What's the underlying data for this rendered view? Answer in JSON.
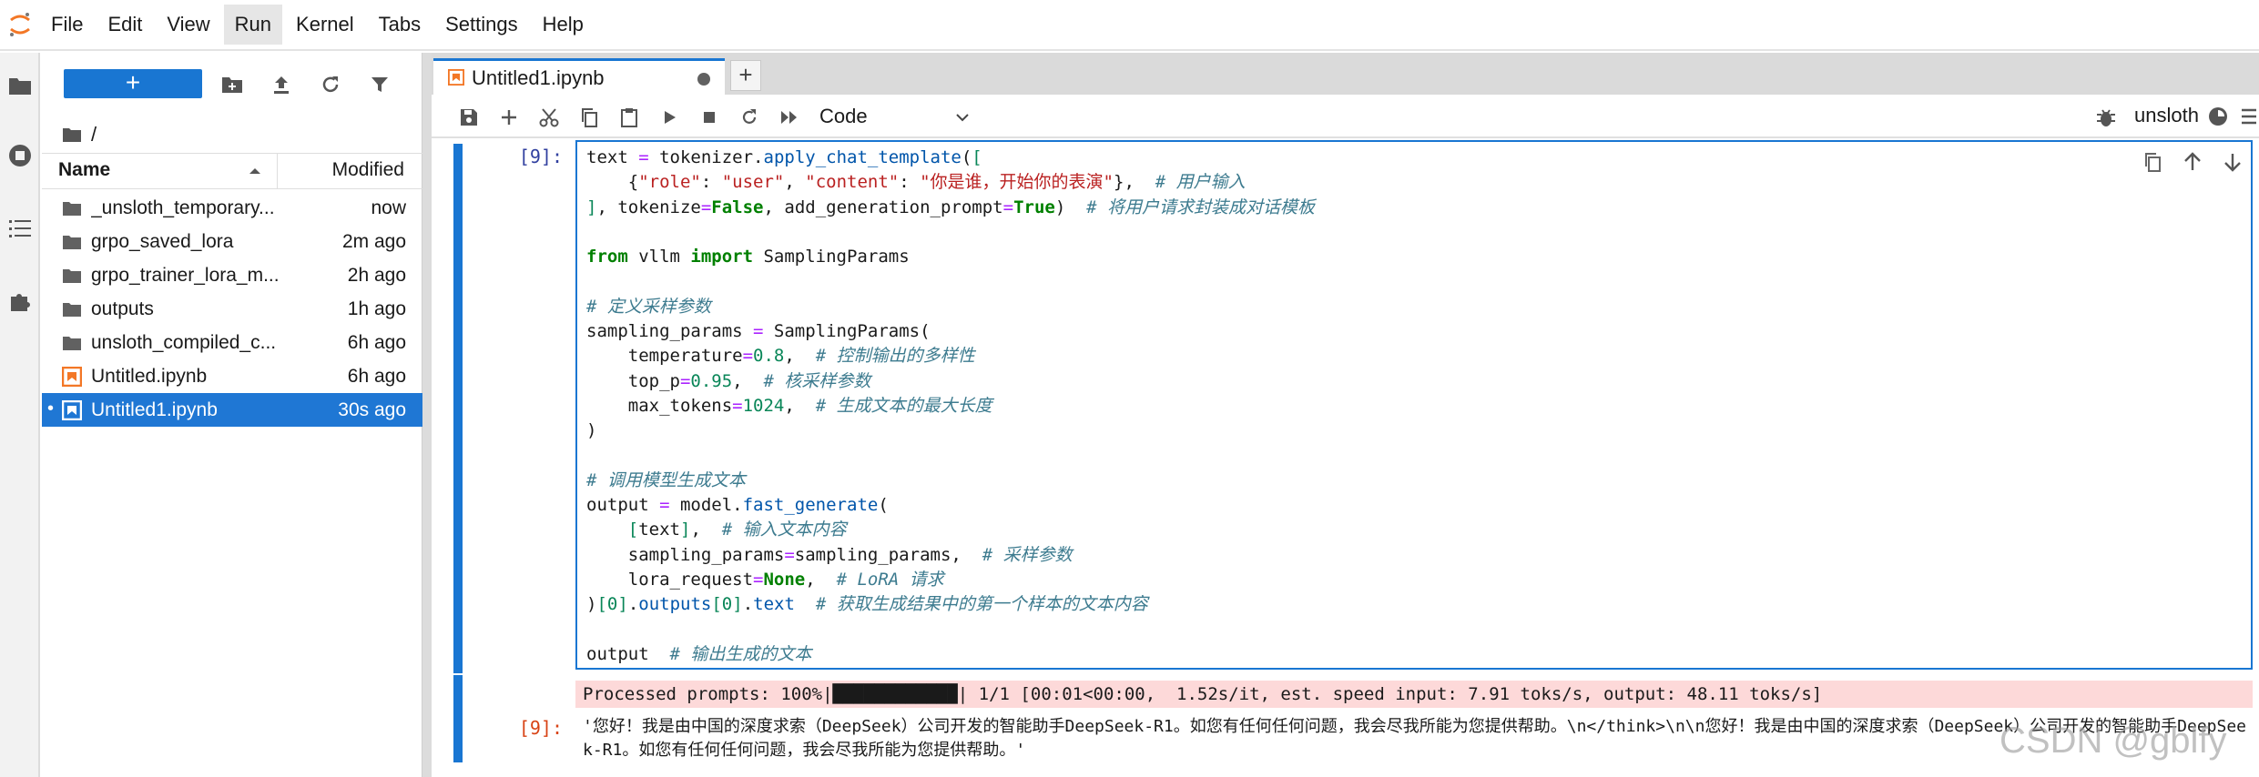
{
  "menubar": {
    "items": [
      "File",
      "Edit",
      "View",
      "Run",
      "Kernel",
      "Tabs",
      "Settings",
      "Help"
    ],
    "active": "Run"
  },
  "filebrowser": {
    "new_label": "+",
    "breadcrumb": "/",
    "columns": {
      "name": "Name",
      "modified": "Modified"
    },
    "files": [
      {
        "name": "_unsloth_temporary...",
        "modified": "now",
        "type": "folder"
      },
      {
        "name": "grpo_saved_lora",
        "modified": "2m ago",
        "type": "folder"
      },
      {
        "name": "grpo_trainer_lora_m...",
        "modified": "2h ago",
        "type": "folder"
      },
      {
        "name": "outputs",
        "modified": "1h ago",
        "type": "folder"
      },
      {
        "name": "unsloth_compiled_c...",
        "modified": "6h ago",
        "type": "folder"
      },
      {
        "name": "Untitled.ipynb",
        "modified": "6h ago",
        "type": "notebook"
      },
      {
        "name": "Untitled1.ipynb",
        "modified": "30s ago",
        "type": "notebook",
        "selected": true,
        "running": true
      }
    ],
    "running_dot": "•"
  },
  "notebook": {
    "tab_title": "Untitled1.ipynb",
    "add_tab": "+",
    "cell_type": "Code",
    "kernel_name": "unsloth",
    "input_prompt": "[9]:",
    "output_prompt": "[9]:",
    "code_lines": [
      "text = tokenizer.apply_chat_template([",
      "    {\"role\": \"user\", \"content\": \"你是谁，开始你的表演\"},  # 用户输入",
      "], tokenize=False, add_generation_prompt=True)  # 将用户请求封装成对话模板",
      "",
      "from vllm import SamplingParams",
      "",
      "# 定义采样参数",
      "sampling_params = SamplingParams(",
      "    temperature=0.8,  # 控制输出的多样性",
      "    top_p=0.95,  # 核采样参数",
      "    max_tokens=1024,  # 生成文本的最大长度",
      ")",
      "",
      "# 调用模型生成文本",
      "output = model.fast_generate(",
      "    [text],  # 输入文本内容",
      "    sampling_params=sampling_params,  # 采样参数",
      "    lora_request=None,  # LoRA 请求",
      ")[0].outputs[0].text  # 获取生成结果中的第一个样本的文本内容",
      "",
      "output  # 输出生成的文本"
    ],
    "stderr": "Processed prompts: 100%|████████████| 1/1 [00:01<00:00,  1.52s/it, est. speed input: 7.91 toks/s, output: 48.11 toks/s]",
    "result": "'您好！我是由中国的深度求索（DeepSeek）公司开发的智能助手DeepSeek-R1。如您有任何任何问题，我会尽我所能为您提供帮助。\\n</think>\\n\\n您好！我是由中国的深度求索（DeepSeek）公司开发的智能助手DeepSeek-R1。如您有任何任何问题，我会尽我所能为您提供帮助。'"
  },
  "watermark": "CSDN @gblfy",
  "colors": {
    "accent": "#1976d2",
    "stderr_bg": "#fdd9d9",
    "selected_row": "#1f77d4"
  }
}
